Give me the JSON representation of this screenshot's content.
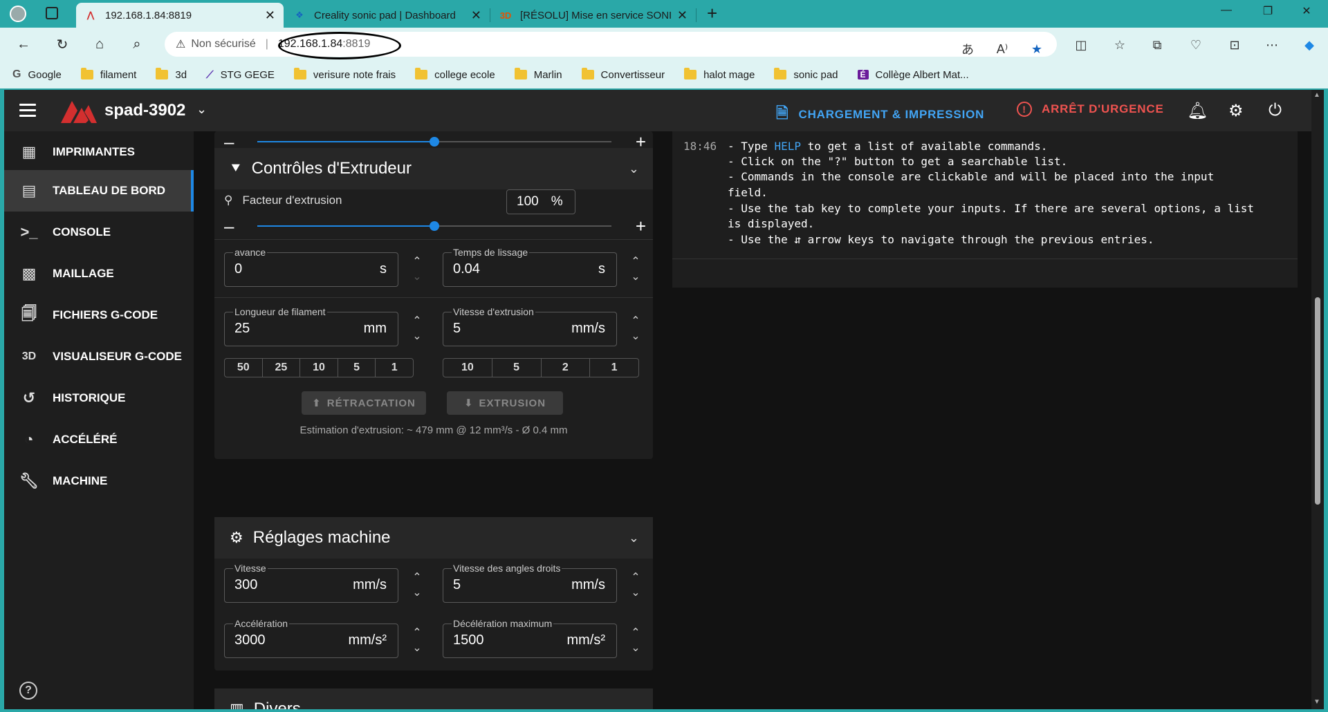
{
  "browser": {
    "tabs": [
      {
        "title": "192.168.1.84:8819",
        "active": true
      },
      {
        "title": "Creality sonic pad | Dashboard",
        "active": false
      },
      {
        "title": "[RÉSOLU] Mise en service SONIC",
        "active": false
      }
    ],
    "new_tab": "+",
    "window_controls": {
      "minimize": "—",
      "restore": "❐",
      "close": "✕"
    },
    "address": {
      "security_label": "Non sécurisé",
      "host": "192.168.1.84",
      "port": ":8819"
    },
    "bookmarks": [
      "Google",
      "filament",
      "3d",
      "STG GEGE",
      "verisure note frais",
      "college ecole",
      "Marlin",
      "Convertisseur",
      "halot mage",
      "sonic pad",
      "Collège Albert Mat..."
    ]
  },
  "app": {
    "printer_name": "spad-3902",
    "actions": {
      "upload_print": "CHARGEMENT & IMPRESSION",
      "emergency_stop": "ARRÊT D'URGENCE"
    },
    "nav": [
      {
        "label": "IMPRIMANTES",
        "icon": "grid-icon",
        "active": false
      },
      {
        "label": "TABLEAU DE BORD",
        "icon": "dashboard-icon",
        "active": true
      },
      {
        "label": "CONSOLE",
        "icon": "console-icon",
        "active": false
      },
      {
        "label": "MAILLAGE",
        "icon": "mesh-icon",
        "active": false
      },
      {
        "label": "FICHIERS G-CODE",
        "icon": "files-icon",
        "active": false
      },
      {
        "label": "VISUALISEUR G-CODE",
        "icon": "3d-icon",
        "active": false
      },
      {
        "label": "HISTORIQUE",
        "icon": "history-icon",
        "active": false
      },
      {
        "label": "ACCÉLÉRÉ",
        "icon": "timelapse-icon",
        "active": false
      },
      {
        "label": "MACHINE",
        "icon": "wrench-icon",
        "active": false
      }
    ],
    "top_slider_fraction": 0.5,
    "extruder": {
      "title": "Contrôles d'Extrudeur",
      "factor_label": "Facteur d'extrusion",
      "factor_value": "100",
      "factor_unit": "%",
      "factor_slider_fraction": 0.5,
      "pressure_advance": {
        "label": "avance",
        "value": "0",
        "unit": "s"
      },
      "smooth_time": {
        "label": "Temps de lissage",
        "value": "0.04",
        "unit": "s"
      },
      "filament_length": {
        "label": "Longueur de filament",
        "value": "25",
        "unit": "mm"
      },
      "extrusion_speed": {
        "label": "Vitesse d'extrusion",
        "value": "5",
        "unit": "mm/s"
      },
      "length_presets": [
        "50",
        "25",
        "10",
        "5",
        "1"
      ],
      "speed_presets": [
        "10",
        "5",
        "2",
        "1"
      ],
      "retract_label": "RÉTRACTATION",
      "extrude_label": "EXTRUSION",
      "estimate": "Estimation d'extrusion: ~ 479 mm @ 12 mm³/s - Ø 0.4 mm"
    },
    "machine": {
      "title": "Réglages machine",
      "velocity": {
        "label": "Vitesse",
        "value": "300",
        "unit": "mm/s"
      },
      "square_corner": {
        "label": "Vitesse des angles droits",
        "value": "5",
        "unit": "mm/s"
      },
      "accel": {
        "label": "Accélération",
        "value": "3000",
        "unit": "mm/s²"
      },
      "decel": {
        "label": "Décélération maximum",
        "value": "1500",
        "unit": "mm/s²"
      }
    },
    "misc_title": "Divers",
    "console": {
      "time": "18:46",
      "lines": [
        {
          "pre": "- Type ",
          "highlight": "HELP",
          "post": " to get a list of available commands."
        },
        {
          "pre": "- Click on the \"?\" button to get a searchable list.",
          "highlight": "",
          "post": ""
        },
        {
          "pre": "- Commands in the console are clickable and will be placed into the input",
          "highlight": "",
          "post": ""
        },
        {
          "pre": "field.",
          "highlight": "",
          "post": ""
        },
        {
          "pre": "- Use the tab key to complete your inputs. If there are several options, a list",
          "highlight": "",
          "post": ""
        },
        {
          "pre": "is displayed.",
          "highlight": "",
          "post": ""
        },
        {
          "pre": "- Use the ⇵ arrow keys to navigate through the previous entries.",
          "highlight": "",
          "post": ""
        }
      ]
    }
  },
  "colors": {
    "accent": "#1e88e5",
    "danger": "#ef5350",
    "teal": "#2aa8a8"
  }
}
